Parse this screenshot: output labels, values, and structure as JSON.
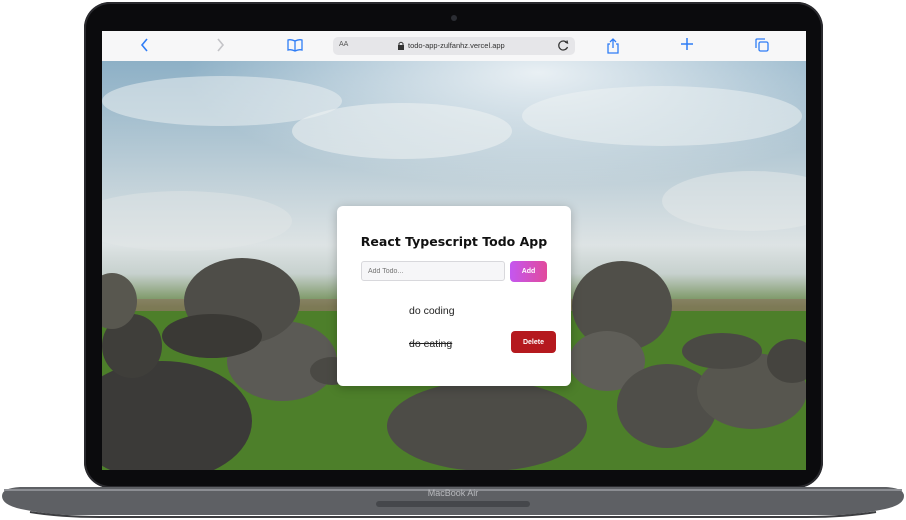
{
  "device": {
    "label": "MacBook Air"
  },
  "browser": {
    "url_aa": "AA",
    "url": "todo-app-zulfanhz.vercel.app",
    "icons": {
      "back": "chevron-left-icon",
      "forward": "chevron-right-icon",
      "bookmarks": "book-icon",
      "lock": "lock-icon",
      "reload": "reload-icon",
      "share": "share-icon",
      "new_tab": "plus-icon",
      "tabs": "tabs-icon"
    },
    "accent": "#2f7df6"
  },
  "app": {
    "title": "React Typescript Todo App",
    "input_placeholder": "Add Todo...",
    "add_label": "Add",
    "todos": [
      {
        "text": "do coding",
        "completed": false
      },
      {
        "text": "do eating",
        "completed": true
      }
    ],
    "delete_label": "Delete",
    "colors": {
      "add_start": "#c457f0",
      "add_end": "#e14a9c",
      "delete": "#b5191e"
    }
  }
}
